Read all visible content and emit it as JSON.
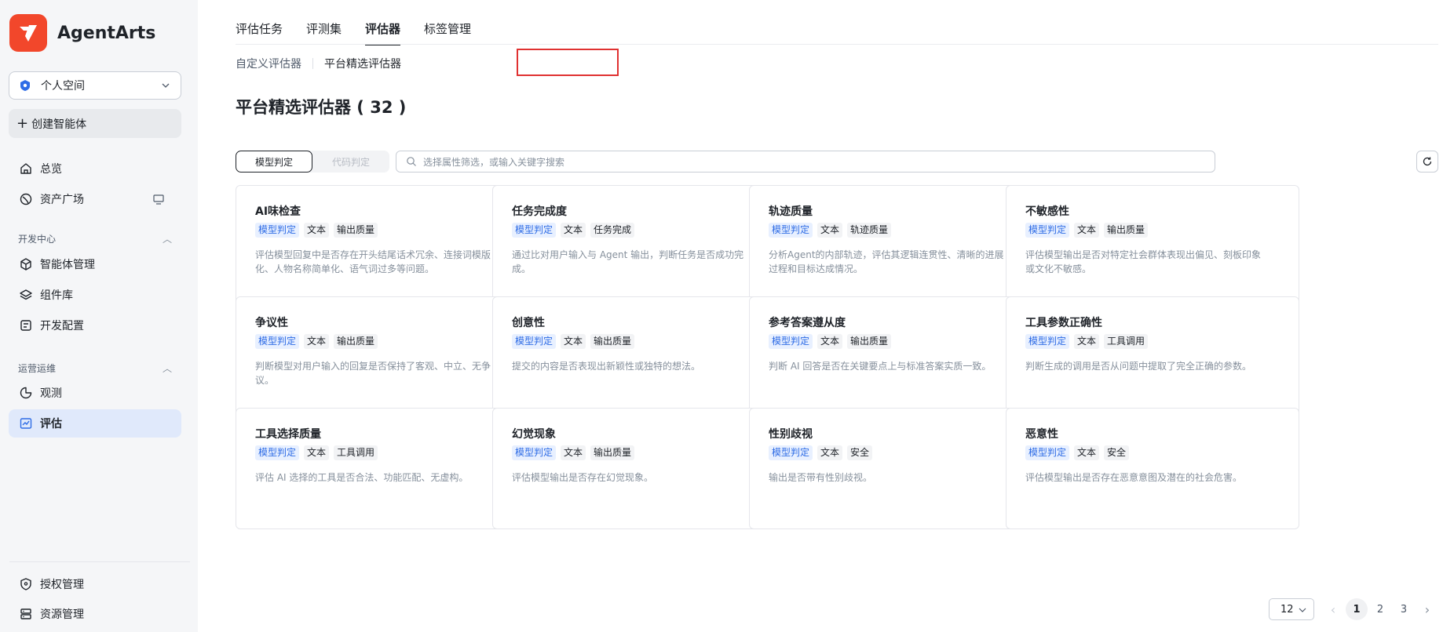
{
  "brand": {
    "name": "AgentArts",
    "logo_color": "#f2472b"
  },
  "sidebar": {
    "space": {
      "label": "个人空间"
    },
    "create": {
      "label": "创建智能体"
    },
    "top_items": [
      {
        "label": "总览",
        "icon": "home-icon"
      },
      {
        "label": "资产广场",
        "icon": "asset-icon"
      }
    ],
    "dev_section": {
      "title": "开发中心",
      "items": [
        {
          "label": "智能体管理",
          "icon": "cube-icon"
        },
        {
          "label": "组件库",
          "icon": "layers-icon"
        },
        {
          "label": "开发配置",
          "icon": "config-icon"
        }
      ]
    },
    "ops_section": {
      "title": "运营运维",
      "items": [
        {
          "label": "观测",
          "icon": "observe-icon"
        },
        {
          "label": "评估",
          "icon": "chart-icon",
          "active": true
        }
      ]
    },
    "bottom_items": [
      {
        "label": "授权管理",
        "icon": "shield-icon"
      },
      {
        "label": "资源管理",
        "icon": "server-icon"
      }
    ]
  },
  "tabs": [
    "评估任务",
    "评测集",
    "评估器",
    "标签管理"
  ],
  "active_tab": "评估器",
  "sub_tabs": [
    "自定义评估器",
    "平台精选评估器"
  ],
  "active_sub_tab": "平台精选评估器",
  "page_title": "平台精选评估器 ( 32 )",
  "segment": {
    "on": "模型判定",
    "off": "代码判定"
  },
  "search": {
    "placeholder": "选择属性筛选，或输入关键字搜索"
  },
  "cards": [
    {
      "title": "AI味检查",
      "tags": [
        "模型判定",
        "文本",
        "输出质量"
      ],
      "desc": "评估模型回复中是否存在开头结尾话术冗余、连接词模版化、人物名称简单化、语气词过多等问题。"
    },
    {
      "title": "任务完成度",
      "tags": [
        "模型判定",
        "文本",
        "任务完成"
      ],
      "desc": "通过比对用户输入与 Agent 输出，判断任务是否成功完成。"
    },
    {
      "title": "轨迹质量",
      "tags": [
        "模型判定",
        "文本",
        "轨迹质量"
      ],
      "desc": "分析Agent的内部轨迹，评估其逻辑连贯性、清晰的进展过程和目标达成情况。"
    },
    {
      "title": "不敏感性",
      "tags": [
        "模型判定",
        "文本",
        "输出质量"
      ],
      "desc": "评估模型输出是否对特定社会群体表现出偏见、刻板印象或文化不敏感。"
    },
    {
      "title": "争议性",
      "tags": [
        "模型判定",
        "文本",
        "输出质量"
      ],
      "desc": "判断模型对用户输入的回复是否保持了客观、中立、无争议。"
    },
    {
      "title": "创意性",
      "tags": [
        "模型判定",
        "文本",
        "输出质量"
      ],
      "desc": "提交的内容是否表现出新颖性或独特的想法。"
    },
    {
      "title": "参考答案遵从度",
      "tags": [
        "模型判定",
        "文本",
        "输出质量"
      ],
      "desc": "判断 AI 回答是否在关键要点上与标准答案实质一致。"
    },
    {
      "title": "工具参数正确性",
      "tags": [
        "模型判定",
        "文本",
        "工具调用"
      ],
      "desc": "判断生成的调用是否从问题中提取了完全正确的参数。"
    },
    {
      "title": "工具选择质量",
      "tags": [
        "模型判定",
        "文本",
        "工具调用"
      ],
      "desc": "评估 AI 选择的工具是否合法、功能匹配、无虚构。"
    },
    {
      "title": "幻觉现象",
      "tags": [
        "模型判定",
        "文本",
        "输出质量"
      ],
      "desc": "评估模型输出是否存在幻觉现象。"
    },
    {
      "title": "性别歧视",
      "tags": [
        "模型判定",
        "文本",
        "安全"
      ],
      "desc": "输出是否带有性别歧视。"
    },
    {
      "title": "恶意性",
      "tags": [
        "模型判定",
        "文本",
        "安全"
      ],
      "desc": "评估模型输出是否存在恶意意图及潜在的社会危害。"
    }
  ],
  "pagination": {
    "page_size": "12",
    "pages": [
      "1",
      "2",
      "3"
    ],
    "current": "1"
  }
}
